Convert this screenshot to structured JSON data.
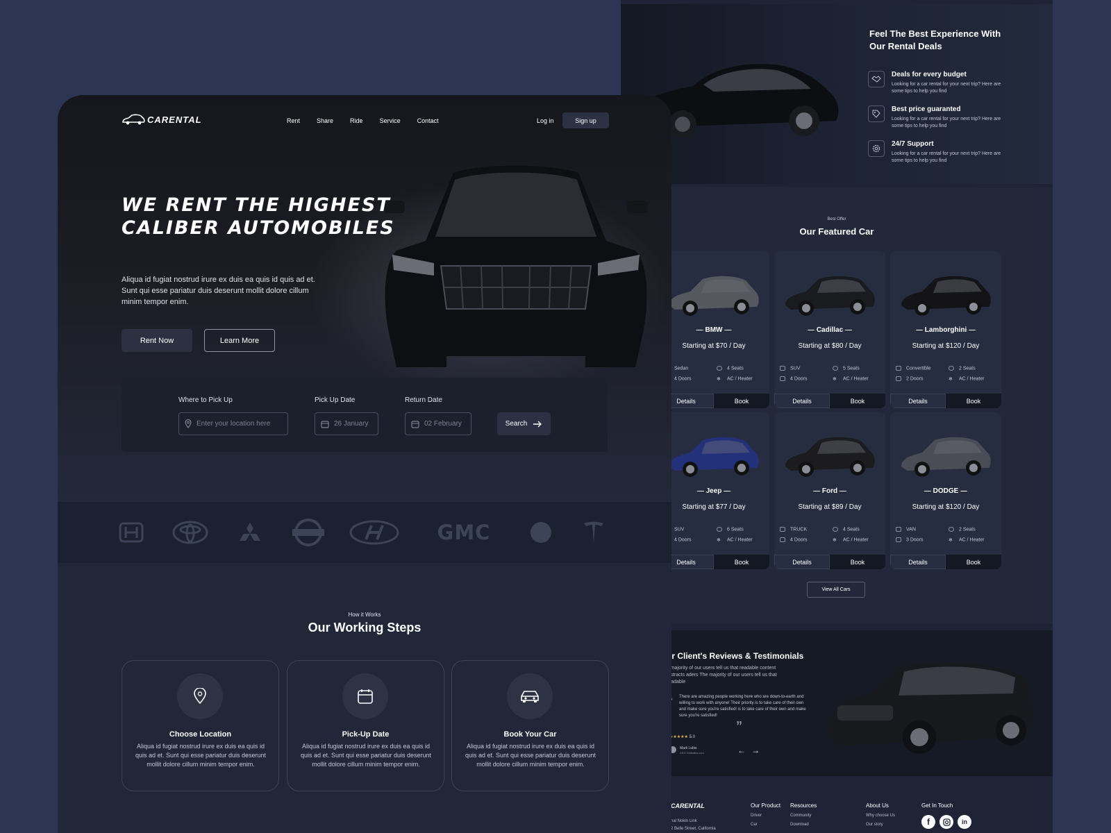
{
  "back": {
    "experience": {
      "title": "Feel The Best Experience With Our Rental Deals",
      "features": [
        {
          "title": "Deals for every budget",
          "desc": "Looking for a car rental for your next trip? Here are some tips to help you find",
          "icon": "handshake-icon"
        },
        {
          "title": "Best price guaranted",
          "desc": "Looking for a car rental for your next trip? Here are some tips to help you find",
          "icon": "price-tag-icon"
        },
        {
          "title": "24/7 Support",
          "desc": "Looking for a car rental for your next trip? Here are some tips to help you find",
          "icon": "gear-icon"
        }
      ]
    },
    "featured": {
      "kicker": "Best Offer",
      "title": "Our Featured Car",
      "cars": [
        {
          "name": "— BMW —",
          "price": "Starting at  $70 / Day",
          "type": "Sedan",
          "doors": "4 Doors",
          "seats": "4 Seats",
          "ac": "AC / Heater",
          "color": "#55585e",
          "details": "Details",
          "book": "Book"
        },
        {
          "name": "— Cadillac —",
          "price": "Starting at  $80 / Day",
          "type": "SUV",
          "doors": "4 Doors",
          "seats": "5 Seats",
          "ac": "AC / Heater",
          "color": "#1a1b1f",
          "details": "Details",
          "book": "Book"
        },
        {
          "name": "— Lamborghini —",
          "price": "Starting at  $120 / Day",
          "type": "Convertible",
          "doors": "2 Doors",
          "seats": "2 Seats",
          "ac": "AC / Heater",
          "color": "#141416",
          "details": "Details",
          "book": "Book"
        },
        {
          "name": "— Jeep —",
          "price": "Starting at  $77 / Day",
          "type": "SUV",
          "doors": "4 Doors",
          "seats": "6 Seats",
          "ac": "AC / Heater",
          "color": "#23307a",
          "details": "Details",
          "book": "Book"
        },
        {
          "name": "— Ford —",
          "price": "Starting at  $89 / Day",
          "type": "TRUCK",
          "doors": "4 Doors",
          "seats": "4 Seats",
          "ac": "AC / Heater",
          "color": "#1c1c1f",
          "details": "Details",
          "book": "Book"
        },
        {
          "name": "— DODGE —",
          "price": "Starting at  $120 / Day",
          "type": "VAN",
          "doors": "3 Doors",
          "seats": "2 Seats",
          "ac": "AC / Heater",
          "color": "#4a4d55",
          "details": "Details",
          "book": "Book"
        }
      ],
      "view_all": "View All Cars"
    },
    "reviews": {
      "title": "ur Client's Reviews & Testimonials",
      "sub": "e majority of our users tell us that readable content distracts aders The majority of our users tell us that readable",
      "quote": "There are amazing people working here who are down-to-earth and willing to work with anyone! Their priority is to take care of their own and make sure you're satisfied! is to take care of their own and make sure you're satisfied!",
      "rating": "5.0",
      "author": "Mark Lubis",
      "role": "CEO Globaltro.com"
    },
    "footer": {
      "address_1": "nal Nokin Link",
      "address_2": "2 Belle Street, California",
      "cols": [
        {
          "title": "Our Product",
          "links": [
            "Driver",
            "Car"
          ]
        },
        {
          "title": "Resources",
          "links": [
            "Community",
            "Download"
          ]
        },
        {
          "title": "About Us",
          "links": [
            "Why choose Us",
            "Our story"
          ]
        },
        {
          "title": "Get In Touch",
          "links": []
        }
      ]
    }
  },
  "front": {
    "logo": "CARENTAL",
    "nav": [
      "Rent",
      "Share",
      "Ride",
      "Service",
      "Contact"
    ],
    "login": "Log in",
    "signup": "Sign up",
    "hero": {
      "title": "WE RENT THE HIGHEST CALIBER AUTOMOBILES",
      "lead": "Aliqua id fugiat nostrud irure ex duis ea quis id quis ad et. Sunt qui esse pariatur duis deserunt mollit dolore cillum minim tempor enim.",
      "btn_primary": "Rent Now",
      "btn_secondary": "Learn More"
    },
    "search": {
      "location_label": "Where to Pick Up",
      "location_placeholder": "Enter your location here",
      "pickup_label": "Pick Up Date",
      "pickup_value": "26 January",
      "return_label": "Return Date",
      "return_value": "02 February",
      "button": "Search"
    },
    "brands": [
      "Honda",
      "Toyota",
      "Mitsubishi",
      "Nissan",
      "Hyundai",
      "GMC",
      "Circle brand",
      "Tesla"
    ],
    "steps": {
      "kicker": "How it Works",
      "title": "Our Working Steps",
      "items": [
        {
          "title": "Choose Location",
          "desc": "Aliqua id fugiat nostrud irure ex duis ea quis id quis ad et. Sunt qui esse pariatur duis deserunt mollit dolore cillum minim tempor enim.",
          "icon": "map-pin-icon"
        },
        {
          "title": "Pick-Up Date",
          "desc": "Aliqua id fugiat nostrud irure ex duis ea quis id quis ad et. Sunt qui esse pariatur duis deserunt mollit dolore cillum minim tempor enim.",
          "icon": "calendar-icon"
        },
        {
          "title": "Book Your Car",
          "desc": "Aliqua id fugiat nostrud irure ex duis ea quis id quis ad et. Sunt qui esse pariatur duis deserunt mollit dolore cillum minim tempor enim.",
          "icon": "car-icon"
        }
      ]
    }
  },
  "colors": {
    "background": "#2c3654",
    "panel": "#212739",
    "card": "#262d41",
    "accent_dark": "#141823"
  }
}
